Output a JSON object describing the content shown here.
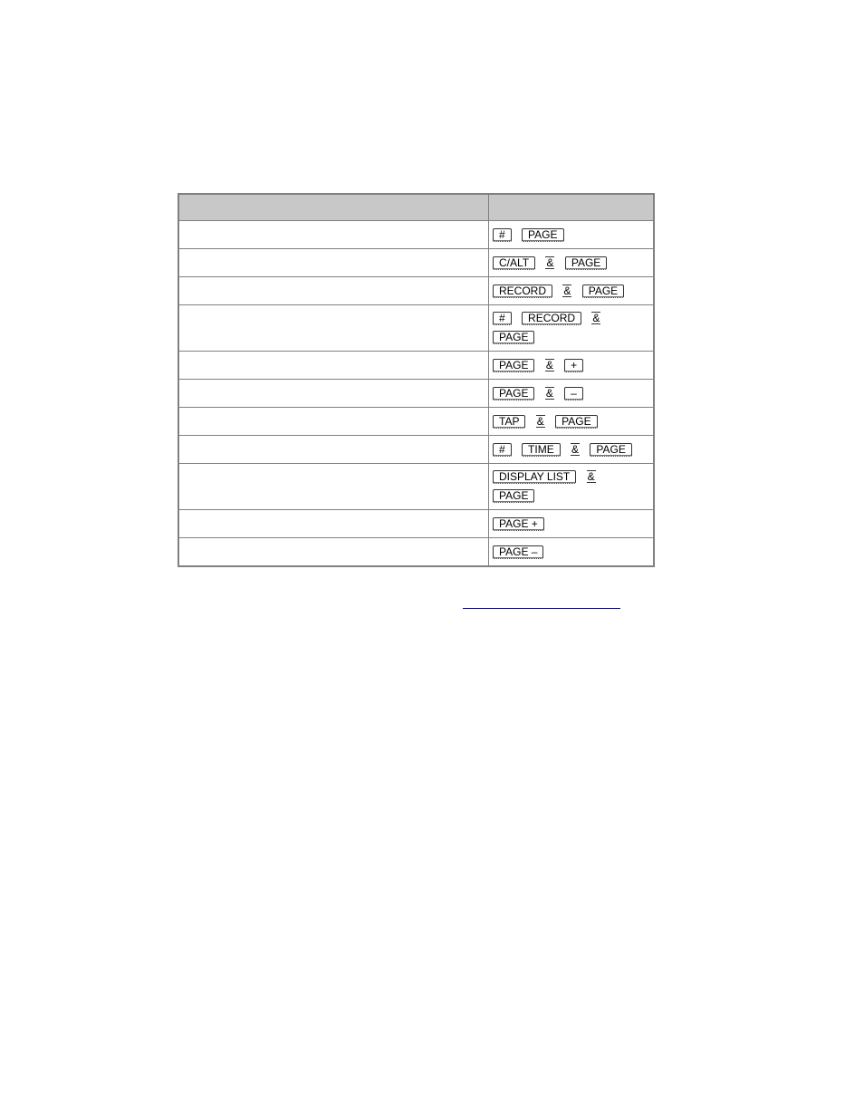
{
  "table": {
    "header": {
      "col_description": "",
      "col_keys": ""
    },
    "rows": [
      {
        "description": "",
        "keys": [
          "#",
          "PAGE"
        ],
        "joiners": [
          "",
          ""
        ]
      },
      {
        "description": "",
        "keys": [
          "C/ALT",
          "PAGE"
        ],
        "joiners": [
          "&",
          ""
        ]
      },
      {
        "description": "",
        "keys": [
          "RECORD",
          "PAGE"
        ],
        "joiners": [
          "&",
          ""
        ]
      },
      {
        "description": "",
        "keys": [
          "#",
          "RECORD",
          "PAGE"
        ],
        "joiners": [
          "",
          "&",
          ""
        ]
      },
      {
        "description": "",
        "keys": [
          "PAGE",
          "+"
        ],
        "joiners": [
          "&",
          ""
        ]
      },
      {
        "description": "",
        "keys": [
          "PAGE",
          "–"
        ],
        "joiners": [
          "&",
          ""
        ]
      },
      {
        "description": "",
        "keys": [
          "TAP",
          "PAGE"
        ],
        "joiners": [
          "&",
          ""
        ]
      },
      {
        "description": "",
        "keys": [
          "#",
          "TIME",
          "PAGE"
        ],
        "joiners": [
          "",
          "&",
          ""
        ]
      },
      {
        "description": "",
        "keys": [
          "DISPLAY LIST",
          "PAGE"
        ],
        "joiners": [
          "&",
          ""
        ]
      },
      {
        "description": "",
        "keys": [
          "PAGE +"
        ],
        "joiners": [
          ""
        ]
      },
      {
        "description": "",
        "keys": [
          "PAGE –"
        ],
        "joiners": [
          ""
        ]
      }
    ],
    "amp_symbol": "&"
  },
  "footer_link": {
    "text": ""
  },
  "colors": {
    "header_bg": "#c8c8c8",
    "border": "#808080",
    "link": "#0000cc"
  }
}
